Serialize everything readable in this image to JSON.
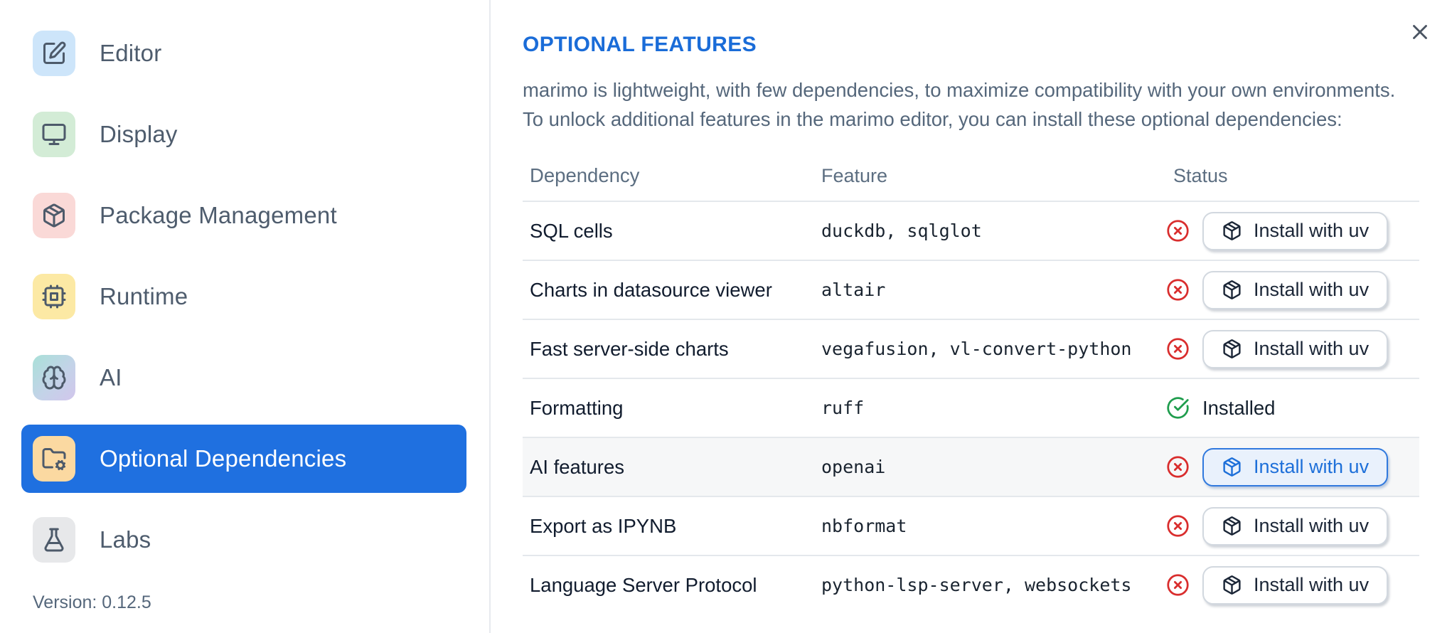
{
  "sidebar": {
    "items": [
      {
        "label": "Editor",
        "icon": "square-pen-icon",
        "icon_bg": "#cde5fa",
        "selected": false
      },
      {
        "label": "Display",
        "icon": "monitor-icon",
        "icon_bg": "#d3ecd6",
        "selected": false
      },
      {
        "label": "Package Management",
        "icon": "package-icon",
        "icon_bg": "#fad9d7",
        "selected": false
      },
      {
        "label": "Runtime",
        "icon": "cpu-icon",
        "icon_bg": "#fce9a4",
        "selected": false
      },
      {
        "label": "AI",
        "icon": "brain-icon",
        "icon_bg": "teal-purple-gradient",
        "selected": false
      },
      {
        "label": "Optional Dependencies",
        "icon": "folder-cog-icon",
        "icon_bg": "#fbd9a1",
        "selected": true
      },
      {
        "label": "Labs",
        "icon": "flask-icon",
        "icon_bg": "#e7e8ea",
        "selected": false
      }
    ],
    "version": "Version: 0.12.5"
  },
  "panel": {
    "title": "OPTIONAL FEATURES",
    "description_line1": "marimo is lightweight, with few dependencies, to maximize compatibility with your own environments.",
    "description_line2": "To unlock additional features in the marimo editor, you can install these optional dependencies:"
  },
  "table": {
    "columns": {
      "dependency": "Dependency",
      "feature": "Feature",
      "status": "Status"
    },
    "rows": [
      {
        "dependency": "SQL cells",
        "feature": "duckdb, sqlglot",
        "status": "missing",
        "action": "Install with uv",
        "highlighted": false
      },
      {
        "dependency": "Charts in datasource viewer",
        "feature": "altair",
        "status": "missing",
        "action": "Install with uv",
        "highlighted": false
      },
      {
        "dependency": "Fast server-side charts",
        "feature": "vegafusion, vl-convert-python",
        "status": "missing",
        "action": "Install with uv",
        "highlighted": false
      },
      {
        "dependency": "Formatting",
        "feature": "ruff",
        "status": "installed",
        "action": "Installed",
        "highlighted": false
      },
      {
        "dependency": "AI features",
        "feature": "openai",
        "status": "missing",
        "action": "Install with uv",
        "highlighted": true
      },
      {
        "dependency": "Export as IPYNB",
        "feature": "nbformat",
        "status": "missing",
        "action": "Install with uv",
        "highlighted": false
      },
      {
        "dependency": "Language Server Protocol",
        "feature": "python-lsp-server, websockets",
        "status": "missing",
        "action": "Install with uv",
        "highlighted": false
      }
    ]
  },
  "colors": {
    "selected_nav_bg": "#1f70e0",
    "title_blue": "#1a6cd8",
    "status_missing_red": "#d92d2d",
    "status_installed_green": "#1f9d4d",
    "active_button_blue": "#1d6fd9",
    "row_highlight_bg": "#f6f7f8",
    "divider": "#e7eaee"
  }
}
